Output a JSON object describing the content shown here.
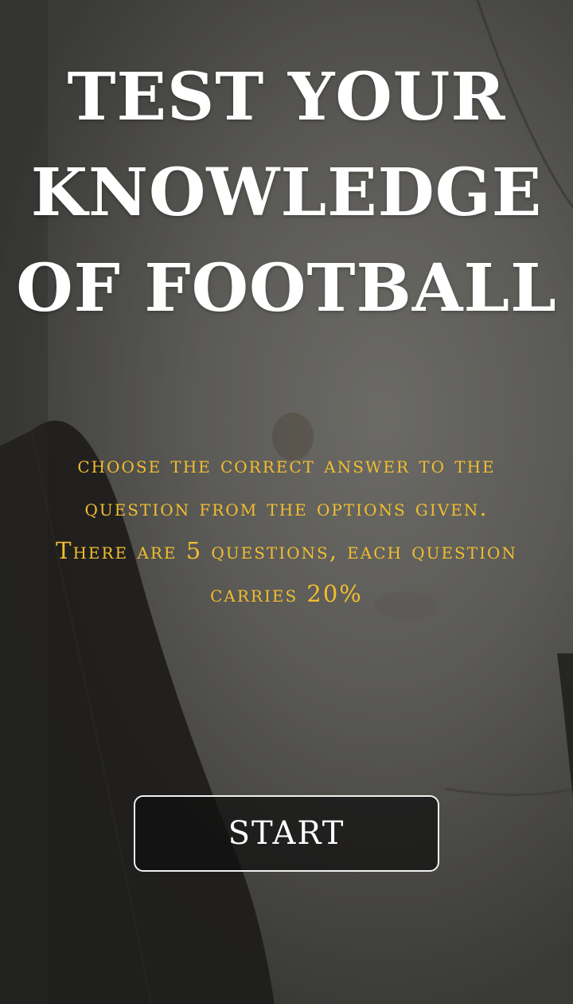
{
  "hero": {
    "title_lines": [
      "TEST YOUR",
      "KNOWLEDGE",
      "OF FOOTBALL"
    ]
  },
  "intro": {
    "instructions": "choose the correct answer to the question from the options given. There are 5 questions, each question carries 20%"
  },
  "actions": {
    "start_label": "START"
  },
  "colors": {
    "title": "#ffffff",
    "instructions": "#f2bd2f",
    "button_border": "#f1f1f1"
  },
  "background": {
    "image": "football-ball-closeup"
  }
}
